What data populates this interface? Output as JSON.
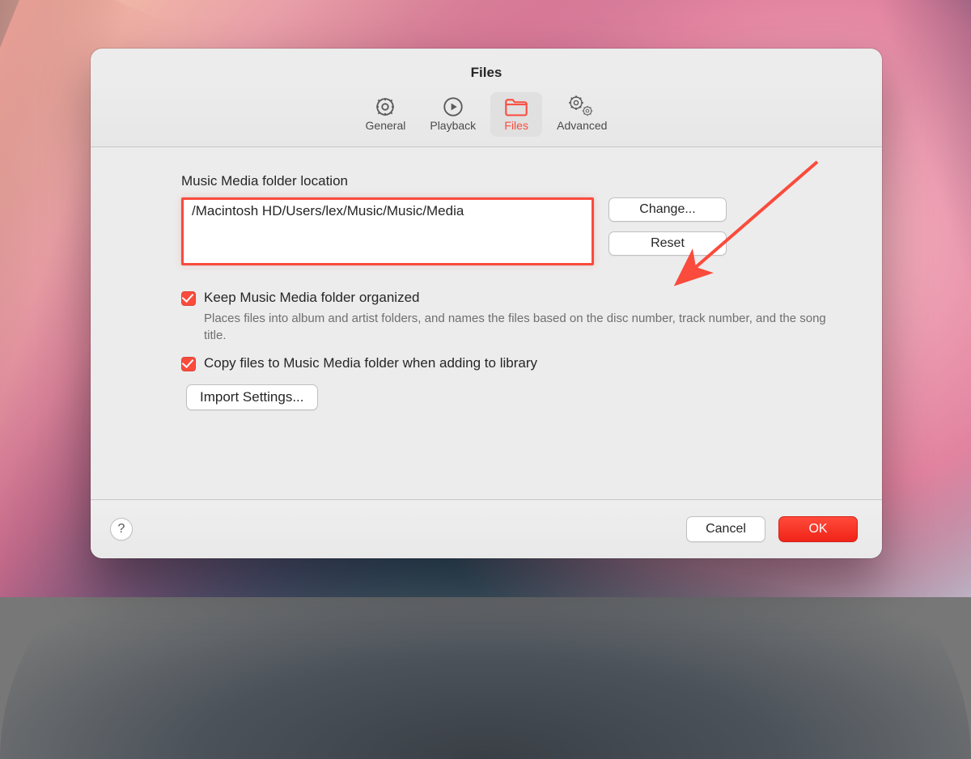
{
  "dialog": {
    "title": "Files",
    "tabs": {
      "general": "General",
      "playback": "Playback",
      "files": "Files",
      "advanced": "Advanced"
    },
    "section_label": "Music Media folder location",
    "media_path": "/Macintosh HD/Users/lex/Music/Music/Media",
    "buttons": {
      "change": "Change...",
      "reset": "Reset",
      "import_settings": "Import Settings...",
      "help": "?",
      "cancel": "Cancel",
      "ok": "OK"
    },
    "checkboxes": {
      "keep_organized": {
        "label": "Keep Music Media folder organized",
        "checked": true,
        "help": "Places files into album and artist folders, and names the files based on the disc number, track number, and the song title."
      },
      "copy_files": {
        "label": "Copy files to Music Media folder when adding to library",
        "checked": true
      }
    }
  },
  "icons": {
    "general": "gear-icon",
    "playback": "play-icon",
    "files": "folder-icon",
    "advanced": "gears-icon"
  },
  "annotation": {
    "highlight_color": "#fa4b3c"
  }
}
